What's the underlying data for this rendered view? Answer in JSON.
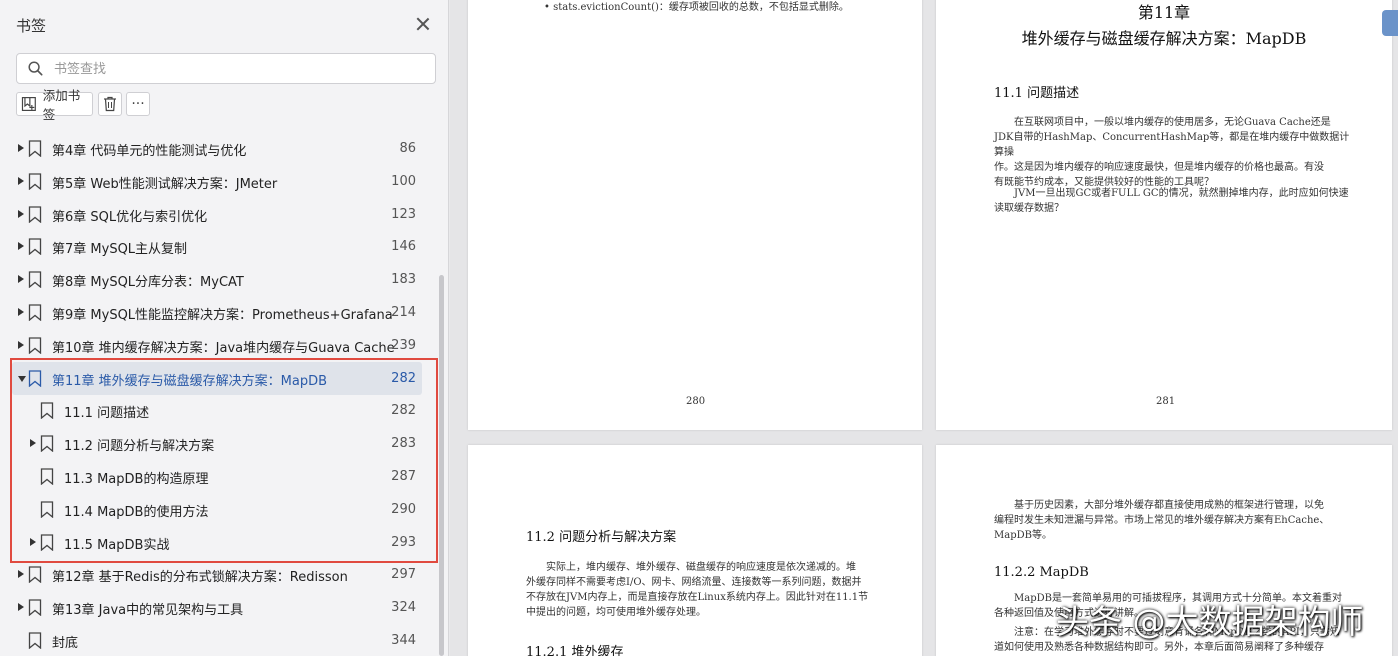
{
  "panel": {
    "title": "书签",
    "search_placeholder": "书签查找",
    "add_label": "添加书签",
    "more_label": "···"
  },
  "bookmarks": [
    {
      "label": "第4章 代码单元的性能测试与优化",
      "page": "86",
      "level": 0,
      "arrow": "right"
    },
    {
      "label": "第5章 Web性能测试解决方案：JMeter",
      "page": "100",
      "level": 0,
      "arrow": "right"
    },
    {
      "label": "第6章 SQL优化与索引优化",
      "page": "123",
      "level": 0,
      "arrow": "right"
    },
    {
      "label": "第7章 MySQL主从复制",
      "page": "146",
      "level": 0,
      "arrow": "right"
    },
    {
      "label": "第8章 MySQL分库分表：MyCAT",
      "page": "183",
      "level": 0,
      "arrow": "right"
    },
    {
      "label": "第9章 MySQL性能监控解决方案：Prometheus+Grafana",
      "page": "214",
      "level": 0,
      "arrow": "right"
    },
    {
      "label": "第10章 堆内缓存解决方案：Java堆内缓存与Guava Cache",
      "page": "239",
      "level": 0,
      "arrow": "right"
    },
    {
      "label": "第11章 堆外缓存与磁盘缓存解决方案：MapDB",
      "page": "282",
      "level": 0,
      "arrow": "down",
      "active": true
    },
    {
      "label": "11.1 问题描述",
      "page": "282",
      "level": 1,
      "arrow": "none"
    },
    {
      "label": "11.2 问题分析与解决方案",
      "page": "283",
      "level": 1,
      "arrow": "right"
    },
    {
      "label": "11.3 MapDB的构造原理",
      "page": "287",
      "level": 1,
      "arrow": "none"
    },
    {
      "label": "11.4 MapDB的使用方法",
      "page": "290",
      "level": 1,
      "arrow": "none"
    },
    {
      "label": "11.5 MapDB实战",
      "page": "293",
      "level": 1,
      "arrow": "right"
    },
    {
      "label": "第12章 基于Redis的分布式锁解决方案：Redisson",
      "page": "297",
      "level": 0,
      "arrow": "right"
    },
    {
      "label": "第13章 Java中的常见架构与工具",
      "page": "324",
      "level": 0,
      "arrow": "right"
    },
    {
      "label": "封底",
      "page": "344",
      "level": 0,
      "arrow": "none"
    }
  ],
  "pages": {
    "p1": {
      "bullet": "• stats.evictionCount()：缓存项被回收的总数，不包括显式删除。",
      "number": "280"
    },
    "p2": {
      "chapter": "第11章",
      "chapter_title": "堆外缓存与磁盘缓存解决方案：MapDB",
      "section": "11.1  问题描述",
      "para1": [
        "在互联网项目中，一般以堆内缓存的使用居多，无论Guava Cache还是",
        "JDK自带的HashMap、ConcurrentHashMap等，都是在堆内缓存中做数据计算操",
        "作。这是因为堆内缓存的响应速度最快，但是堆内缓存的价格也最高。有没",
        "有既能节约成本，又能提供较好的性能的工具呢？"
      ],
      "para2": [
        "JVM一旦出现GC或者FULL GC的情况，就然删掉堆内存，此时应如何快速",
        "读取缓存数据？"
      ],
      "number": "281"
    },
    "p3": {
      "section": "11.2  问题分析与解决方案",
      "para": [
        "实际上，堆内缓存、堆外缓存、磁盘缓存的响应速度是依次递减的。堆",
        "外缓存同样不需要考虑I/O、网卡、网络流量、连接数等一系列问题，数据并",
        "不存放在JVM内存上，而是直接存放在Linux系统内存上。因此针对在11.1节",
        "中提出的问题，均可使用堆外缓存处理。"
      ],
      "subsection": "11.2.1  堆外缓存"
    },
    "p4": {
      "para1": [
        "基于历史因素，大部分堆外缓存都直接使用成熟的框架进行管理，以免",
        "编程时发生未知泄漏与异常。市场上常见的堆外缓存解决方案有EhCache、",
        "MapDB等。"
      ],
      "subsection": "11.2.2  MapDB",
      "para2": [
        "MapDB是一套简单易用的可插拔程序，其调用方式十分简单。本文着重对",
        "各种返回值及使用方式进行讲解。",
        "注意：在学习堆外缓存时不要过刻意背诵各种MapDB之类的API，只需知",
        "道如何使用及熟悉各种数据结构即可。另外，本章后面简易阐释了多种缓存"
      ]
    }
  },
  "watermark": "头条 @大数据架构师"
}
